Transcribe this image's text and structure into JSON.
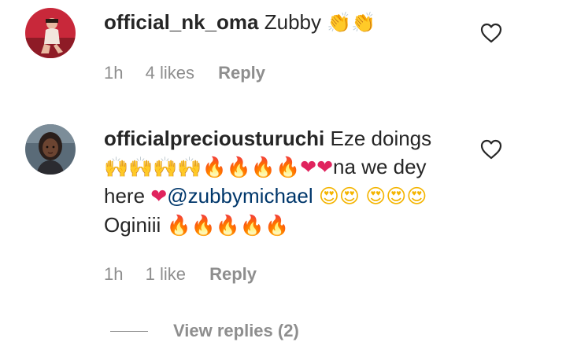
{
  "comments": [
    {
      "username": "official_nk_oma",
      "text": "Zubby",
      "emojis_after": [
        "👏",
        "👏"
      ],
      "time": "1h",
      "likes": "4 likes",
      "reply_label": "Reply"
    },
    {
      "username": "officialpreciousturuchi",
      "text_part1": "Eze doings",
      "emojis_line1": [
        "🙌",
        "🙌",
        "🙌",
        "🙌",
        "🔥",
        "🔥",
        "🔥",
        "🔥",
        "❤",
        "❤"
      ],
      "text_part2": "na we dey here",
      "emoji_heart": "❤",
      "mention": "@zubbymichael",
      "emojis_love": [
        "😍",
        "😍",
        "😍",
        "😍",
        "😍"
      ],
      "text_part3": "Oginiii",
      "emojis_fire": [
        "🔥",
        "🔥",
        "🔥",
        "🔥",
        "🔥"
      ],
      "time": "1h",
      "likes": "1 like",
      "reply_label": "Reply"
    }
  ],
  "view_replies": {
    "label": "View replies (2)"
  },
  "icons": {
    "like": "heart-outline-icon"
  },
  "colors": {
    "text": "#262626",
    "muted": "#8e8e8e",
    "mention": "#00376b"
  }
}
